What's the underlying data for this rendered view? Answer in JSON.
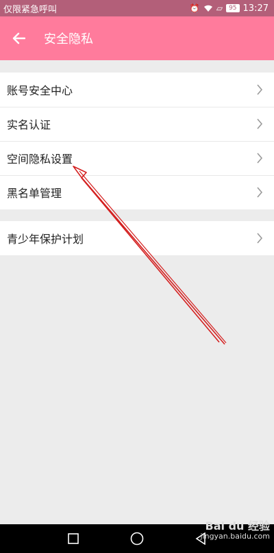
{
  "status_bar": {
    "left_text": "仅限紧急呼叫",
    "battery": "95",
    "time": "13:27"
  },
  "header": {
    "title": "安全隐私",
    "back_icon": "arrow-left-icon"
  },
  "menu": {
    "group1": [
      {
        "label": "账号安全中心"
      },
      {
        "label": "实名认证"
      },
      {
        "label": "空间隐私设置"
      },
      {
        "label": "黑名单管理"
      }
    ],
    "group2": [
      {
        "label": "青少年保护计划"
      }
    ]
  },
  "watermark": {
    "main": "Bai du 经验",
    "sub": "jingyan.baidu.com"
  },
  "colors": {
    "header": "#ff7b9c",
    "status_bar": "#b35f79",
    "arrow": "#d42020"
  }
}
